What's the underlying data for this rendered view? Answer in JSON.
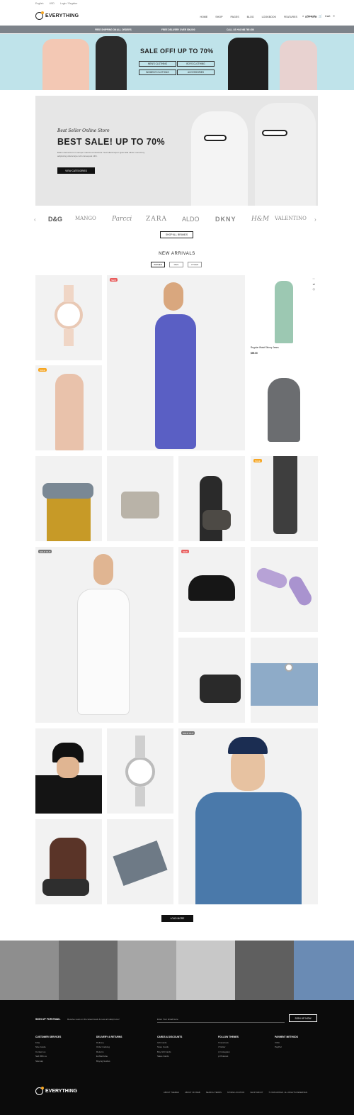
{
  "topbar": {
    "language": "English",
    "currency": "USD",
    "account": "Login / Register"
  },
  "header": {
    "logo": "EVERYTHING",
    "nav": [
      "HOME",
      "SHOP",
      "PAGES",
      "BLOG",
      "LOOKBOOK",
      "FEATURES",
      "BUY NOW"
    ],
    "search_label": "Search",
    "cart_label": "Cart"
  },
  "strip": {
    "items": [
      "FREE SHIPPING ON ALL ORDERS",
      "FREE DELIVERY OVER 500,000",
      "CALL US +84 986 765 456"
    ]
  },
  "promo": {
    "headline": "SALE OFF! UP TO 70%",
    "buttons": [
      "MEN'S CLOTHING",
      "BOYS CLOTHING",
      "WOMEN'S CLOTHING",
      "ACCESSORIES"
    ]
  },
  "hero": {
    "subtitle": "Best Seller Online Store",
    "title": "BEST SALE! UP TO 70%",
    "description": "Etiam elementum in semper mauris consectetur. Sed ullamcorper Quis fella ullt for nonummy adipiscing ullamcorper elit consequat nibh.",
    "cta": "VIEW CATEGORIES"
  },
  "brands": [
    "D&G",
    "MANGO",
    "Parcci",
    "ZARA",
    "ALDO",
    "DKNY",
    "H&M",
    "VALENTINO"
  ],
  "shop_brands_label": "SHOP ALL BRANDS",
  "new_arrivals": {
    "title": "NEW ARRIVALS",
    "tabs": [
      "WOMEN",
      "MEN",
      "OTHER"
    ],
    "featured_product_name": "Regular Waist Skinny Jeans",
    "featured_product_price": "$99.00",
    "badges": {
      "new": "NEW",
      "sale": "SALE",
      "sold": "SOLD OUT"
    },
    "load_more": "LOAD MORE"
  },
  "footer": {
    "signup_title": "SIGN UP FOR EMAIL",
    "signup_desc": "Receive news on the latest deals & new arrivals/promo!",
    "email_placeholder": "Enter Your Email Here",
    "subscribe": "SIGN UP NOW",
    "columns": [
      {
        "title": "CUSTOMER SERVICES",
        "items": [
          "FAQ",
          "Size Guide",
          "Contact us",
          "Sell With us",
          "Sitemap"
        ]
      },
      {
        "title": "DELIVERY & RETURNS",
        "items": [
          "Delivery",
          "Order tracking",
          "Returns",
          "E-Wardrobe",
          "Buying Guides"
        ]
      },
      {
        "title": "CARDS & DISCOUNTS",
        "items": [
          "Gift Cards",
          "Store Cards",
          "Buy Gift Cards",
          "Sales Cards"
        ]
      },
      {
        "title": "FOLLOW THEMES",
        "items": [
          "Facebook",
          "Twitter",
          "Instagram",
          "Pinterest"
        ]
      },
      {
        "title": "PAYMENT METHODS",
        "items": [
          "VISA",
          "PayPal"
        ]
      }
    ],
    "logo": "EVERYTHING",
    "links": [
      "ABOUT THEMES",
      "ABOUT ON WEB",
      "SEARCH TERMS",
      "STORE LOCATION",
      "SHOP ABOUT",
      "© 2018 AIRNGO. ALL RIGHTS RESERVED."
    ]
  },
  "colors": {
    "accent": "#f6a623",
    "sale_red": "#e85c5c",
    "promo_bg": "#bfe3ea",
    "strip_bg": "#7d838a",
    "footer_bg": "#0b0b0b"
  }
}
